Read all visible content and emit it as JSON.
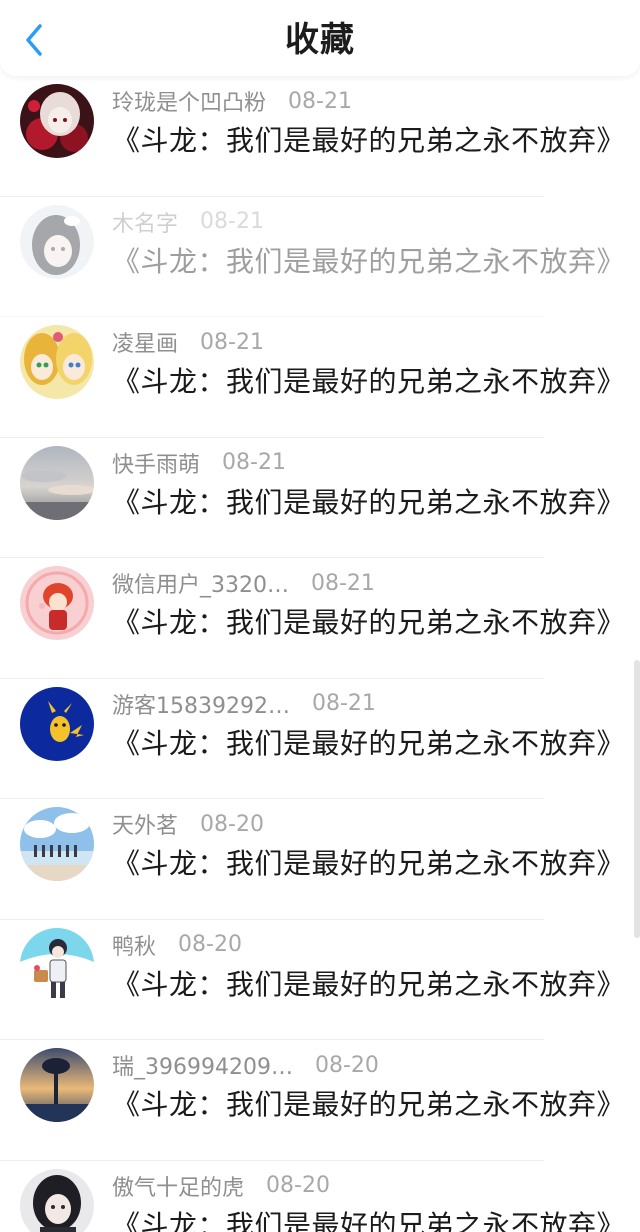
{
  "header": {
    "title": "收藏",
    "back_icon": "chevron-left-icon",
    "accent_color": "#2a9df4"
  },
  "favorites": [
    {
      "user": "玲珑是个凹凸粉",
      "date": "08-21",
      "title": "《斗龙：我们是最好的兄弟之永不放弃》",
      "faded": false
    },
    {
      "user": "木名字",
      "date": "08-21",
      "title": "《斗龙：我们是最好的兄弟之永不放弃》",
      "faded": true
    },
    {
      "user": "凌星画",
      "date": "08-21",
      "title": "《斗龙：我们是最好的兄弟之永不放弃》",
      "faded": false
    },
    {
      "user": "快手雨萌",
      "date": "08-21",
      "title": "《斗龙：我们是最好的兄弟之永不放弃》",
      "faded": false
    },
    {
      "user": "微信用户_3320…",
      "date": "08-21",
      "title": "《斗龙：我们是最好的兄弟之永不放弃》",
      "faded": false
    },
    {
      "user": "游客15839292…",
      "date": "08-21",
      "title": "《斗龙：我们是最好的兄弟之永不放弃》",
      "faded": false
    },
    {
      "user": "天外茗",
      "date": "08-20",
      "title": "《斗龙：我们是最好的兄弟之永不放弃》",
      "faded": false
    },
    {
      "user": "鸭秋",
      "date": "08-20",
      "title": "《斗龙：我们是最好的兄弟之永不放弃》",
      "faded": false
    },
    {
      "user": "瑞_396994209…",
      "date": "08-20",
      "title": "《斗龙：我们是最好的兄弟之永不放弃》",
      "faded": false
    },
    {
      "user": "傲气十足的虎",
      "date": "08-20",
      "title": "《斗龙：我们是最好的兄弟之永不放弃》",
      "faded": false
    }
  ]
}
